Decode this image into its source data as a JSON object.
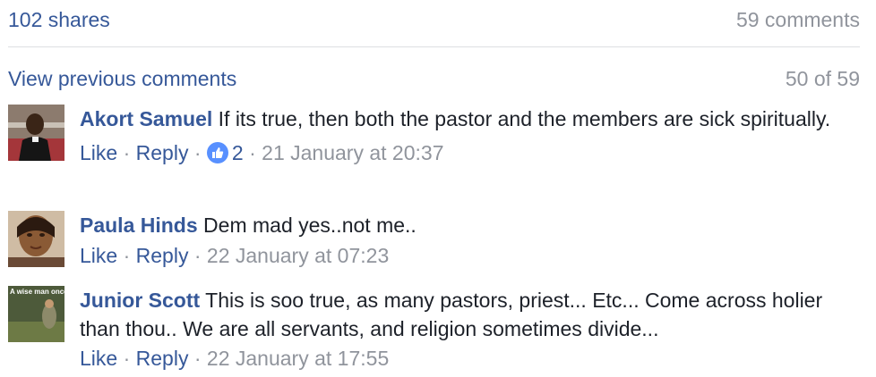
{
  "header": {
    "shares": "102 shares",
    "comments": "59 comments"
  },
  "pagination": {
    "view_previous": "View previous comments",
    "position": "50 of 59"
  },
  "actions": {
    "like": "Like",
    "reply": "Reply",
    "separator": "·"
  },
  "comments": [
    {
      "author": "Akort Samuel",
      "text": "If its true, then both the pastor and the members are sick spiritually.",
      "like_count": "2",
      "timestamp": "21 January at 20:37"
    },
    {
      "author": "Paula Hinds",
      "text": "Dem mad yes..not me..",
      "timestamp": "22 January at 07:23"
    },
    {
      "author": "Junior Scott",
      "text": "This is soo true, as many pastors, priest... Etc... Come across holier than thou.. We are all servants, and religion sometimes divide...",
      "timestamp": "22 January at 17:55",
      "avatar_text": "A wise man once said nothing."
    }
  ],
  "colors": {
    "link": "#365899",
    "meta": "#90949c",
    "like_badge": "#5890ff",
    "divider": "#dddfe2"
  },
  "icons": {
    "like_badge": "thumbs-up-icon"
  }
}
